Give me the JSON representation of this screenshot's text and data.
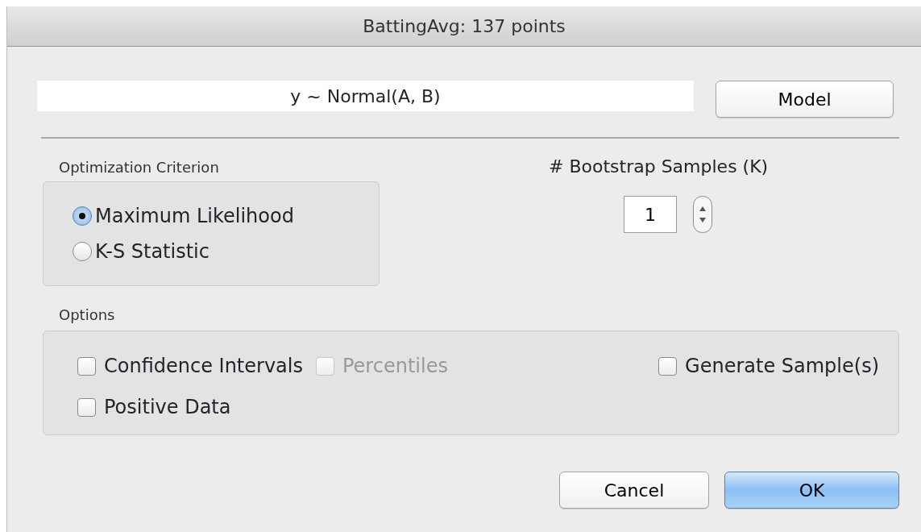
{
  "window": {
    "title": "BattingAvg: 137 points"
  },
  "model": {
    "formula": "y ~ Normal(A, B)",
    "button": "Model"
  },
  "criterion": {
    "title": "Optimization Criterion",
    "options": [
      {
        "label": "Maximum Likelihood",
        "selected": true
      },
      {
        "label": "K-S Statistic",
        "selected": false
      }
    ]
  },
  "bootstrap": {
    "label": "# Bootstrap Samples (K)",
    "value": "1"
  },
  "options": {
    "title": "Options",
    "rows": [
      {
        "left": [
          {
            "label": "Confidence Intervals",
            "checked": false,
            "disabled": false
          },
          {
            "label": "Percentiles",
            "checked": false,
            "disabled": true
          }
        ],
        "right": [
          {
            "label": "Generate Sample(s)",
            "checked": false,
            "disabled": false
          }
        ]
      },
      {
        "left": [
          {
            "label": "Positive Data",
            "checked": false,
            "disabled": false
          }
        ],
        "right": []
      }
    ]
  },
  "buttons": [
    {
      "label": "Cancel",
      "default": false
    },
    {
      "label": "OK",
      "default": true
    }
  ]
}
